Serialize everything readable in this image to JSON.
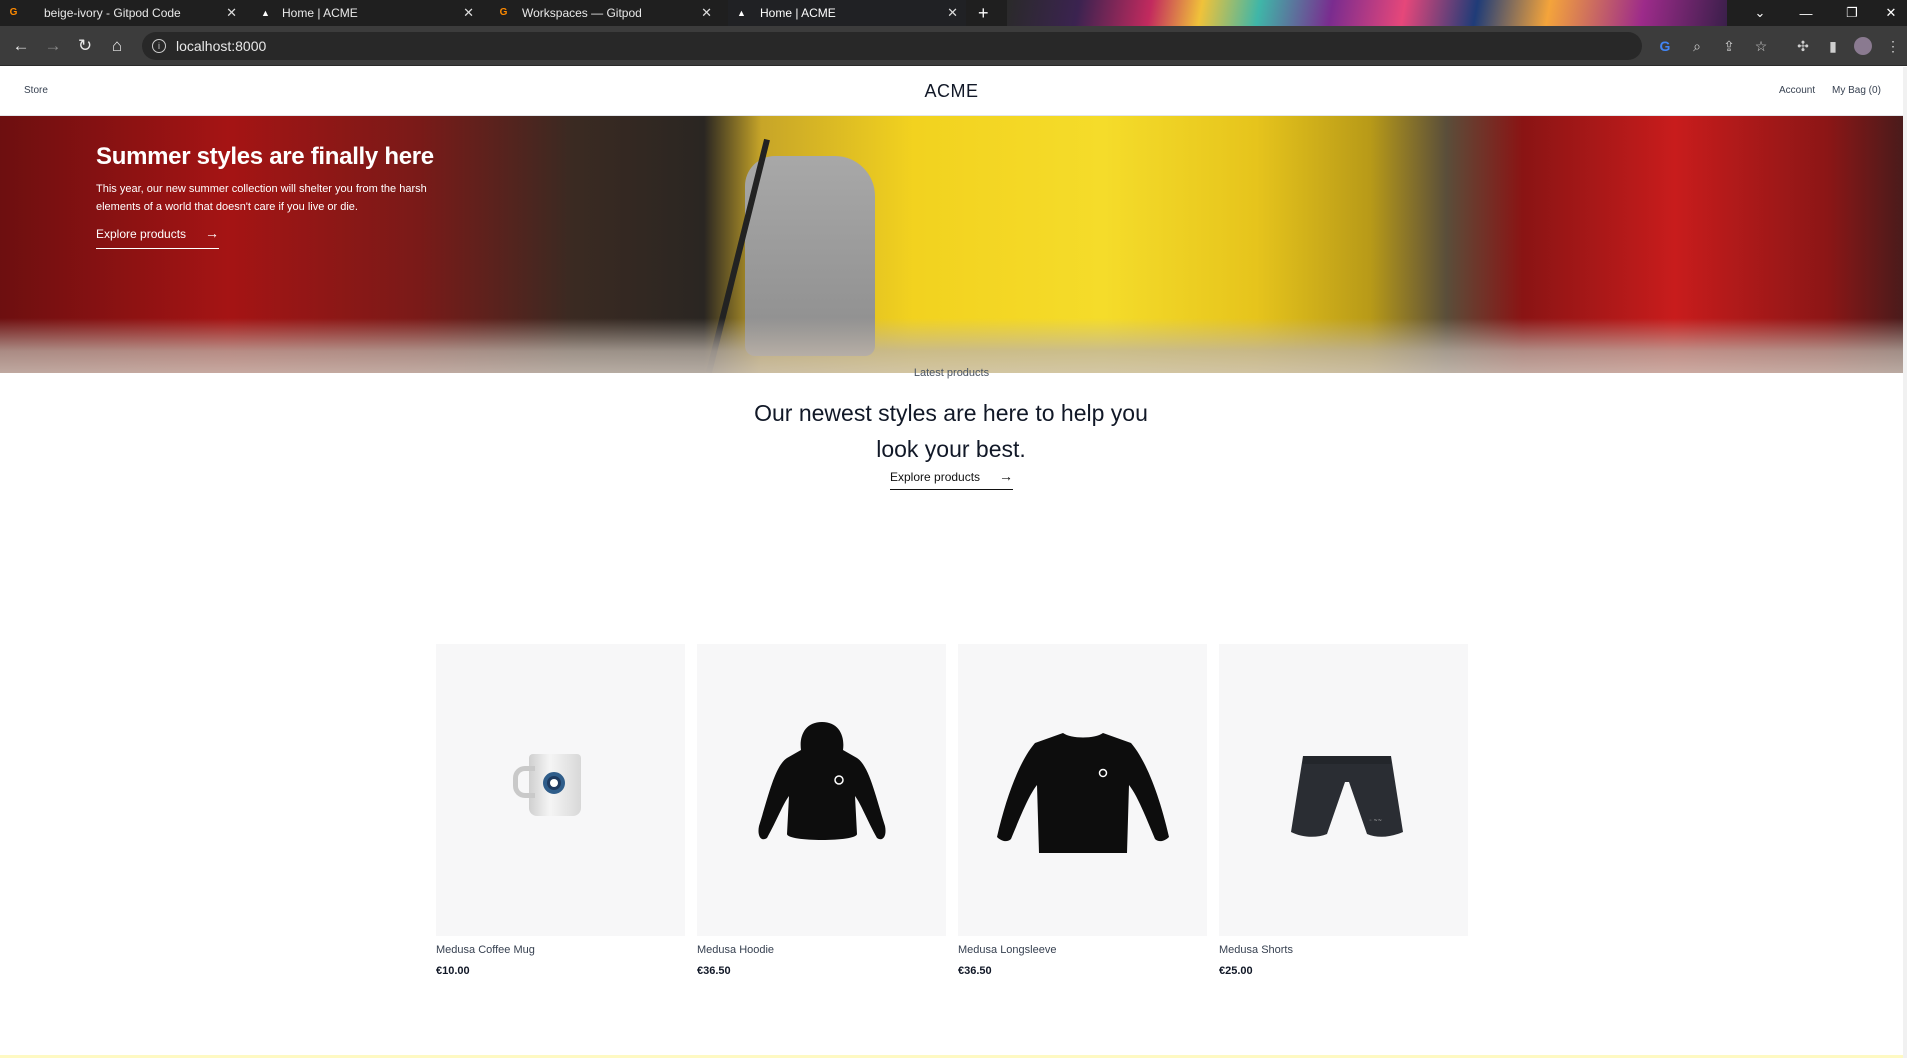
{
  "browser": {
    "tabs": [
      {
        "title": "beige-ivory - Gitpod Code",
        "favicon": "gitpod-icon"
      },
      {
        "title": "Home | ACME",
        "favicon": "triangle-icon"
      },
      {
        "title": "Workspaces — Gitpod",
        "favicon": "gitpod-icon"
      },
      {
        "title": "Home | ACME",
        "favicon": "triangle-icon",
        "active": true
      }
    ],
    "url": "localhost:8000"
  },
  "site": {
    "nav": {
      "store": "Store",
      "brand": "ACME",
      "account": "Account",
      "bag": "My Bag (0)"
    },
    "hero": {
      "title": "Summer styles are finally here",
      "text": "This year, our new summer collection will shelter you from the harsh elements of a world that doesn't care if you live or die.",
      "cta": "Explore products"
    },
    "latest": {
      "eyebrow": "Latest products",
      "headline": "Our newest styles are here to help you look your best.",
      "cta": "Explore products"
    },
    "products": [
      {
        "name": "Medusa Coffee Mug",
        "price": "€10.00"
      },
      {
        "name": "Medusa Hoodie",
        "price": "€36.50"
      },
      {
        "name": "Medusa Longsleeve",
        "price": "€36.50"
      },
      {
        "name": "Medusa Shorts",
        "price": "€25.00"
      }
    ]
  },
  "colors": {
    "page_bg": "#ffffff",
    "card_bg": "#f7f7f8",
    "text": "#111827",
    "tab_bar": "#1f1f1f",
    "toolbar": "#3c3c3c"
  }
}
